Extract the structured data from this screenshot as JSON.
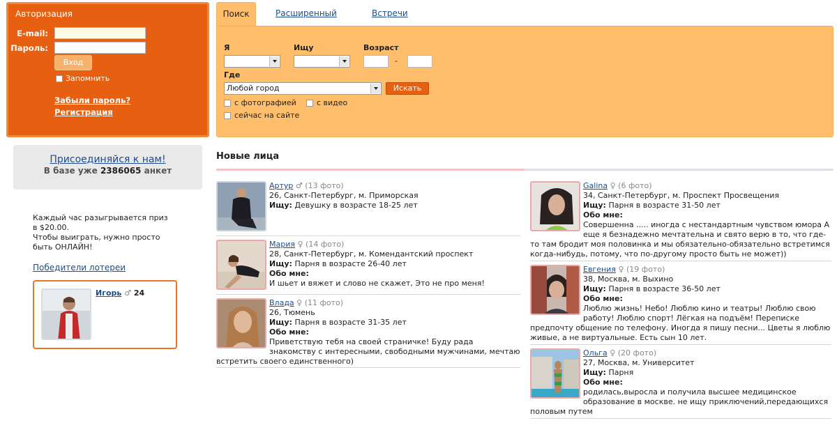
{
  "auth": {
    "title": "Авторизация",
    "email_label": "E-mail:",
    "password_label": "Пароль:",
    "email_value": "",
    "password_value": "",
    "login_button": "Вход",
    "remember_label": "Запомнить",
    "forgot_link": "Забыли пароль?",
    "register_link": "Регистрация"
  },
  "join": {
    "link": "Присоединяйся к нам!",
    "count_prefix": "В базе уже",
    "count": "2386065",
    "count_suffix": "анкет"
  },
  "promo": {
    "line1": "Каждый час разыгрывается приз",
    "line2": "в $20.00.",
    "line3": "Чтобы выиграть, нужно просто",
    "line4": "быть ОНЛАЙН!"
  },
  "winners": {
    "link": "Победители лотереи",
    "name": "Игорь",
    "gender_symbol": "♂",
    "age": "24"
  },
  "search": {
    "tabs": [
      "Поиск",
      "Расширенный",
      "Встречи"
    ],
    "i_label": "Я",
    "seek_label": "Ищу",
    "age_label": "Возраст",
    "age_dash": "-",
    "where_label": "Где",
    "city_value": "Любой город",
    "search_button": "Искать",
    "opt_photo": "с фотографией",
    "opt_video": "с видео",
    "opt_online": "сейчас на сайте"
  },
  "new_faces": {
    "title": "Новые лица",
    "left": [
      {
        "name": "Артур",
        "symbol": "♂",
        "photos": "(13 фото)",
        "location": "26, Санкт-Петербург, м. Приморская",
        "seek_label": "Ищу:",
        "seek": "Девушку в возрасте 18-25 лет",
        "about_label": "",
        "about": ""
      },
      {
        "name": "Мария",
        "symbol": "♀",
        "photos": "(14 фото)",
        "location": "28, Санкт-Петербург, м. Комендантский проспект",
        "seek_label": "Ищу:",
        "seek": "Парня в возрасте 26-40 лет",
        "about_label": "Обо мне:",
        "about": "И шьет и вяжет и слово не скажет, Это не про меня!"
      },
      {
        "name": "Влада",
        "symbol": "♀",
        "photos": "(11 фото)",
        "location": "26, Тюмень",
        "seek_label": "Ищу:",
        "seek": "Парня в возрасте 31-35 лет",
        "about_label": "Обо мне:",
        "about_a": "Приветствую тебя на своей страничке! Буду рада",
        "about_b": "знакомству с интересными, свободными мужчинами, мечтаю",
        "about_c": "встретить своего единственного)"
      }
    ],
    "right": [
      {
        "name": "Galina",
        "symbol": "♀",
        "photos": "(6 фото)",
        "location": "34, Санкт-Петербург, м. Проспект Просвещения",
        "seek_label": "Ищу:",
        "seek": "Парня в возрасте 31-50 лет",
        "about_label": "Обо мне:",
        "about_a": "Совершенна ..... иногда с нестандартным чувством юмора А",
        "about_b": "еще я безнадежно мечтательна и свято верю в то, что где-",
        "about_c": "то там бродит моя половинка и мы обязательно-обязательно встретимся",
        "about_d": "когда-нибудь, потому, что по-другому просто быть не может))"
      },
      {
        "name": "Евгения",
        "symbol": "♀",
        "photos": "(19 фото)",
        "location": "38, Москва, м. Выхино",
        "seek_label": "Ищу:",
        "seek": "Парня в возрасте 36-50 лет",
        "about_label": "Обо мне:",
        "about_a": "Люблю жизнь! Небо! Люблю кино и театры! Люблю свою",
        "about_b": "работу! Люблю спорт! Лёгкая на подъём! Переписке",
        "about_c": "предпочту общение по телефону. Иногда я пишу песни... Цветы я люблю",
        "about_d": "живые, а не виртуальные. Есть сын 10 лет."
      },
      {
        "name": "Ольга",
        "symbol": "♀",
        "photos": "(20 фото)",
        "location": "27, Москва, м. Университет",
        "seek_label": "Ищу:",
        "seek": "Парня",
        "about_label": "Обо мне:",
        "about_a": "родилась,выросла и получила высшее медицинское",
        "about_b": "образование в москве. не ищу приключений,передающихся",
        "about_c": "половым путем"
      }
    ]
  }
}
